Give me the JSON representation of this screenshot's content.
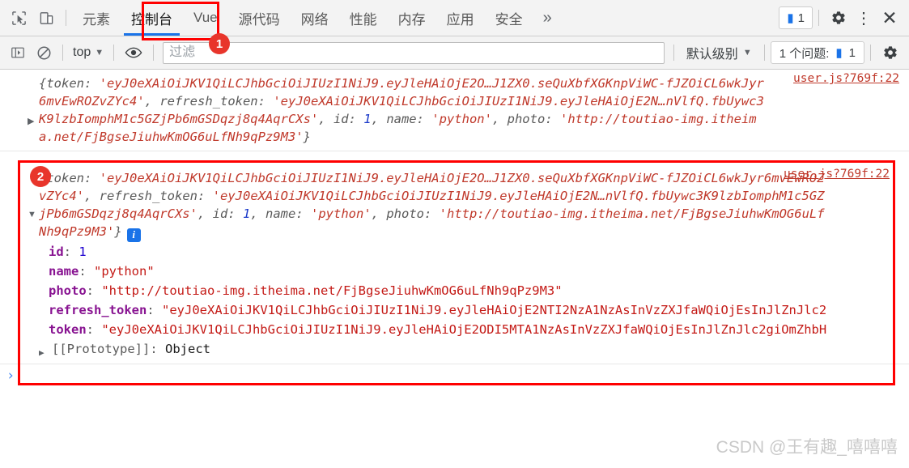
{
  "tabbar": {
    "inspect_icon": "cursor-select-icon",
    "device_icon": "device-toolbar-icon",
    "tabs": [
      {
        "label": "元素",
        "active": false
      },
      {
        "label": "控制台",
        "active": true
      },
      {
        "label": "Vue",
        "active": false
      },
      {
        "label": "源代码",
        "active": false
      },
      {
        "label": "网络",
        "active": false
      },
      {
        "label": "性能",
        "active": false
      },
      {
        "label": "内存",
        "active": false
      },
      {
        "label": "应用",
        "active": false
      },
      {
        "label": "安全",
        "active": false
      }
    ],
    "more_label": "»",
    "issue_count": "1",
    "settings_icon": "gear-icon",
    "kebab_icon": "more-vertical-icon",
    "close_icon": "close-icon"
  },
  "filterbar": {
    "execute_icon": "execute-sidebar-icon",
    "clear_icon": "clear-console-icon",
    "context": "top",
    "caret": "▼",
    "eye_icon": "live-expression-eye-icon",
    "filter_placeholder": "过滤",
    "filter_value": "",
    "level": "默认级别",
    "issues_label": "1 个问题:",
    "issues_count": "1",
    "settings_icon": "gear-icon"
  },
  "console": {
    "entries": [
      {
        "source": "user.js?769f:22",
        "arrow": "▶",
        "expanded": false,
        "preview": {
          "open": "{",
          "parts": [
            {
              "key": "token",
              "value": "'eyJ0eXAiOiJKV1QiLCJhbGciOiJIUzI1NiJ9.eyJleHAiOjE2O…J1ZX0.seQuXbfXGKnpViWC-fJZOiCL6wkJyr6mvEwROZvZYc4'",
              "type": "string"
            },
            {
              "key": "refresh_token",
              "value": "'eyJ0eXAiOiJKV1QiLCJhbGciOiJIUzI1NiJ9.eyJleHAiOjE2N…nVlfQ.fbUywc3K9lzbIomphM1c5GZjPb6mGSDqzj8q4AqrCXs'",
              "type": "string"
            },
            {
              "key": "id",
              "value": "1",
              "type": "number"
            },
            {
              "key": "name",
              "value": "'python'",
              "type": "string"
            },
            {
              "key": "photo",
              "value": "'http://toutiao-img.itheima.net/FjBgseJiuhwKmOG6uLfNh9qPz9M3'",
              "type": "string"
            }
          ],
          "close": "}"
        }
      },
      {
        "source": "user.js?769f:22",
        "arrow": "▼",
        "expanded": true,
        "info_badge": "i",
        "preview": {
          "open": "{",
          "parts": [
            {
              "key": "token",
              "value": "'eyJ0eXAiOiJKV1QiLCJhbGciOiJIUzI1NiJ9.eyJleHAiOjE2O…J1ZX0.seQuXbfXGKnpViWC-fJZOiCL6wkJyr6mvEwROZvZYc4'",
              "type": "string"
            },
            {
              "key": "refresh_token",
              "value": "'eyJ0eXAiOiJKV1QiLCJhbGciOiJIUzI1NiJ9.eyJleHAiOjE2N…nVlfQ.fbUywc3K9lzbIomphM1c5GZjPb6mGSDqzj8q4AqrCXs'",
              "type": "string"
            },
            {
              "key": "id",
              "value": "1",
              "type": "number"
            },
            {
              "key": "name",
              "value": "'python'",
              "type": "string"
            },
            {
              "key": "photo",
              "value": "'http://toutiao-img.itheima.net/FjBgseJiuhwKmOG6uLfNh9qPz9M3'",
              "type": "string"
            }
          ],
          "close": "}"
        },
        "properties": [
          {
            "key": "id",
            "value": "1",
            "type": "number"
          },
          {
            "key": "name",
            "value": "\"python\"",
            "type": "string"
          },
          {
            "key": "photo",
            "value": "\"http://toutiao-img.itheima.net/FjBgseJiuhwKmOG6uLfNh9qPz9M3\"",
            "type": "string"
          },
          {
            "key": "refresh_token",
            "value": "\"eyJ0eXAiOiJKV1QiLCJhbGciOiJIUzI1NiJ9.eyJleHAiOjE2NTI2NzA1NzAsInVzZXJfaWQiOjEsInJlZnJlc2",
            "type": "string"
          },
          {
            "key": "token",
            "value": "\"eyJ0eXAiOiJKV1QiLCJhbGciOiJIUzI1NiJ9.eyJleHAiOjE2ODI5MTA1NzAsInVzZXJfaWQiOjEsInJlZnJlc2giOmZhbH",
            "type": "string"
          }
        ],
        "prototype": {
          "arrow": "▶",
          "name": "[[Prototype]]",
          "value": "Object"
        }
      }
    ],
    "prompt_caret": "›"
  },
  "annotations": {
    "badge1": "1",
    "badge2": "2"
  },
  "watermark": "CSDN @王有趣_嘻嘻嘻",
  "colors": {
    "accent": "#1a73e8",
    "annotation": "#ff0000",
    "badge": "#e8352b",
    "string": "#c41a16",
    "key": "#881391",
    "number": "#1c00cf"
  }
}
